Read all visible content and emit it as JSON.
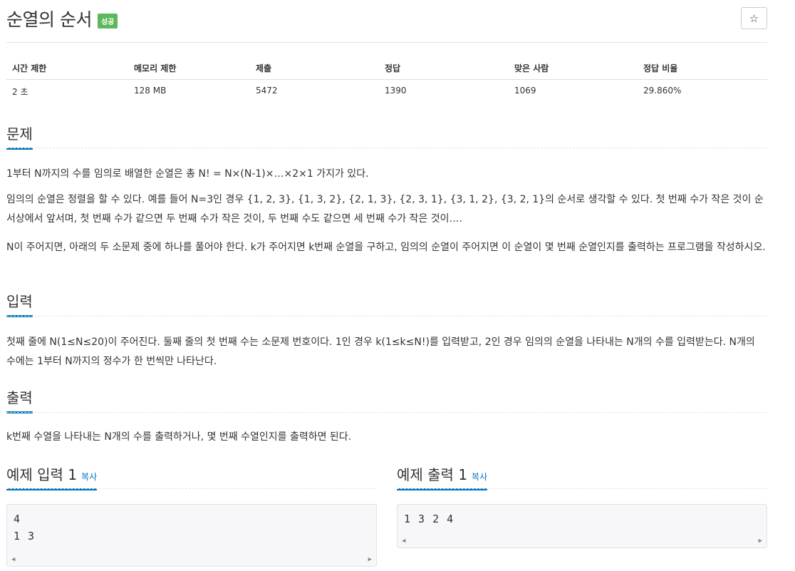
{
  "problem": {
    "title": "순열의 순서",
    "badge": "성공",
    "star_label": "☆"
  },
  "stats": {
    "headers": [
      "시간 제한",
      "메모리 제한",
      "제출",
      "정답",
      "맞은 사람",
      "정답 비율"
    ],
    "values": [
      "2 초",
      "128 MB",
      "5472",
      "1390",
      "1069",
      "29.860%"
    ]
  },
  "sections": {
    "problem_heading": "문제",
    "problem_paragraphs": [
      "1부터 N까지의 수를 임의로 배열한 순열은 총 N! = N×(N-1)×…×2×1 가지가 있다.",
      "임의의 순열은 정렬을 할 수 있다. 예를 들어  N=3인 경우 {1, 2, 3}, {1, 3, 2}, {2, 1, 3}, {2, 3, 1}, {3, 1, 2}, {3, 2, 1}의 순서로 생각할 수 있다. 첫 번째 수가 작은 것이 순서상에서 앞서며, 첫 번째 수가 같으면 두 번째 수가 작은 것이, 두 번째 수도 같으면 세 번째 수가 작은 것이….",
      "N이 주어지면, 아래의 두 소문제 중에 하나를 풀어야 한다. k가 주어지면 k번째 순열을 구하고, 임의의 순열이 주어지면 이 순열이 몇 번째 순열인지를 출력하는 프로그램을 작성하시오."
    ],
    "input_heading": "입력",
    "input_text": "첫째 줄에 N(1≤N≤20)이 주어진다. 둘째 줄의 첫 번째 수는 소문제 번호이다. 1인 경우 k(1≤k≤N!)를 입력받고, 2인 경우 임의의 순열을 나타내는 N개의 수를 입력받는다. N개의 수에는 1부터 N까지의 정수가 한 번씩만 나타난다.",
    "output_heading": "출력",
    "output_text": "k번째 수열을 나타내는 N개의 수를 출력하거나, 몇 번째 수열인지를 출력하면 된다."
  },
  "samples": {
    "input_heading": "예제 입력 1",
    "output_heading": "예제 출력 1",
    "copy_label": "복사",
    "input_content": "4\n1 3",
    "output_content": "1 3 2 4"
  }
}
